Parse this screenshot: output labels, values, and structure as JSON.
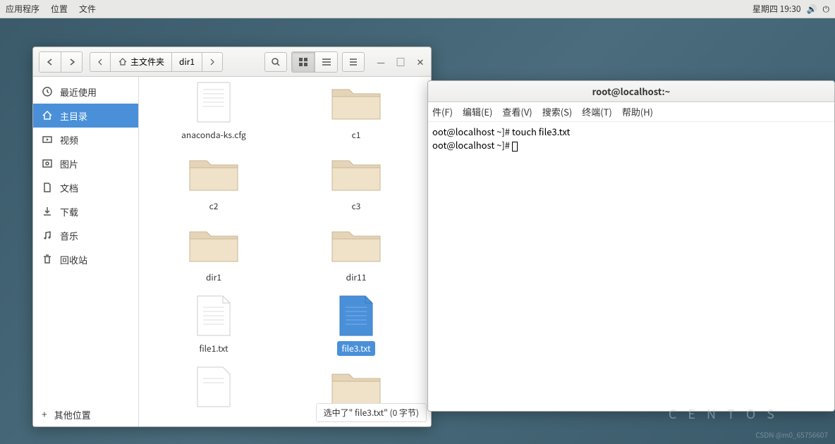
{
  "panel": {
    "apps": "应用程序",
    "places": "位置",
    "files": "文件",
    "datetime": "星期四 19:30"
  },
  "fm": {
    "breadcrumb": {
      "home": "主文件夹",
      "dir": "dir1"
    },
    "status": "选中了\" file3.txt\"   (0 字节)",
    "sidebar": {
      "recent": "最近使用",
      "home": "主目录",
      "videos": "视频",
      "pictures": "图片",
      "documents": "文档",
      "downloads": "下载",
      "music": "音乐",
      "trash": "回收站",
      "other": "其他位置"
    },
    "files": {
      "anaconda": "anaconda-ks.cfg",
      "c1": "c1",
      "c2": "c2",
      "c3": "c3",
      "dir1": "dir1",
      "dir11": "dir11",
      "file1": "file1.txt",
      "file3": "file3.txt"
    }
  },
  "term": {
    "title": "root@localhost:~",
    "menu": {
      "file": "件(F)",
      "edit": "编辑(E)",
      "view": "查看(V)",
      "search": "搜索(S)",
      "terminal": "终端(T)",
      "help": "帮助(H)"
    },
    "line1": "oot@localhost ~]# touch file3.txt",
    "line2": "oot@localhost ~]# "
  },
  "logo": "C E N T O S",
  "watermark": "CSDN @m0_65756607"
}
